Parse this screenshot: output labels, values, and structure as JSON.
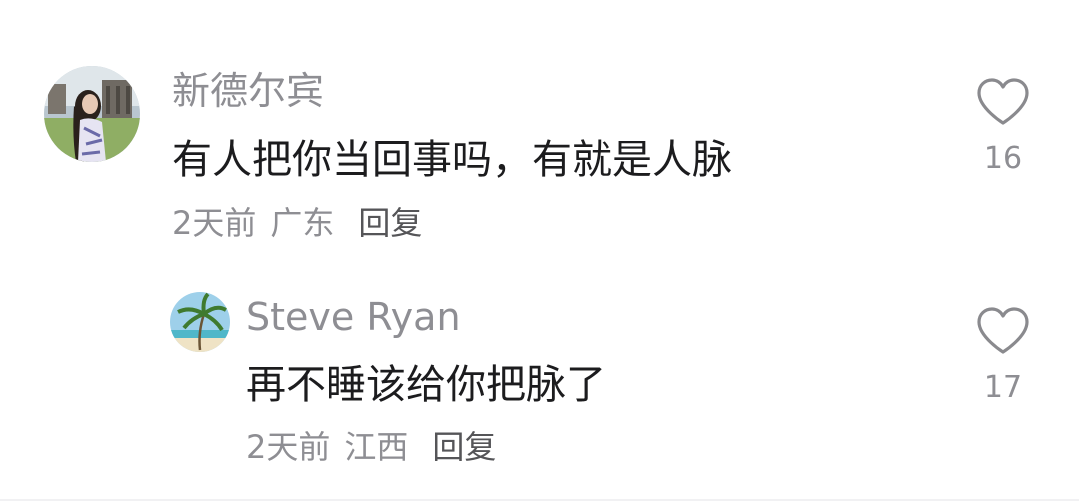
{
  "comments": [
    {
      "username": "新德尔宾",
      "text": "有人把你当回事吗，有就是人脉",
      "time": "2天前",
      "location": "广东",
      "reply_label": "回复",
      "like_count": "16",
      "avatar_icon": "avatar-woman-photo",
      "like_icon": "heart-outline-icon"
    },
    {
      "username": "Steve Ryan",
      "text": "再不睡该给你把脉了",
      "time": "2天前",
      "location": "江西",
      "reply_label": "回复",
      "like_count": "17",
      "avatar_icon": "avatar-palm-beach",
      "like_icon": "heart-outline-icon"
    }
  ],
  "colors": {
    "meta_text": "#8e8e93",
    "body_text": "#1c1c1e",
    "reply_text": "#555558",
    "heart_stroke": "#8a8a8e"
  }
}
